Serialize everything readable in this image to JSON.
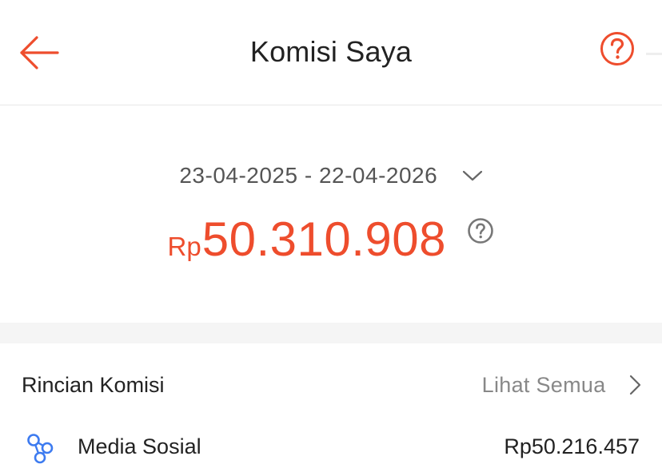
{
  "header": {
    "title": "Komisi Saya",
    "back_icon": "arrow-left-icon",
    "help_icon": "question-circle-icon"
  },
  "summary": {
    "date_range": "23-04-2025 - 22-04-2026",
    "currency_prefix": "Rp",
    "amount": "50.310.908",
    "info_icon": "question-circle-icon"
  },
  "breakdown": {
    "title": "Rincian Komisi",
    "see_all_label": "Lihat Semua",
    "items": [
      {
        "label": "Media Sosial",
        "value": "Rp50.216.457",
        "icon": "share-nodes-icon"
      }
    ]
  },
  "colors": {
    "accent": "#ee4d2d",
    "text_primary": "#222222",
    "text_secondary": "#888888",
    "date_text": "#555555",
    "icon_blue": "#3d7bf0",
    "band": "#f5f5f5"
  }
}
